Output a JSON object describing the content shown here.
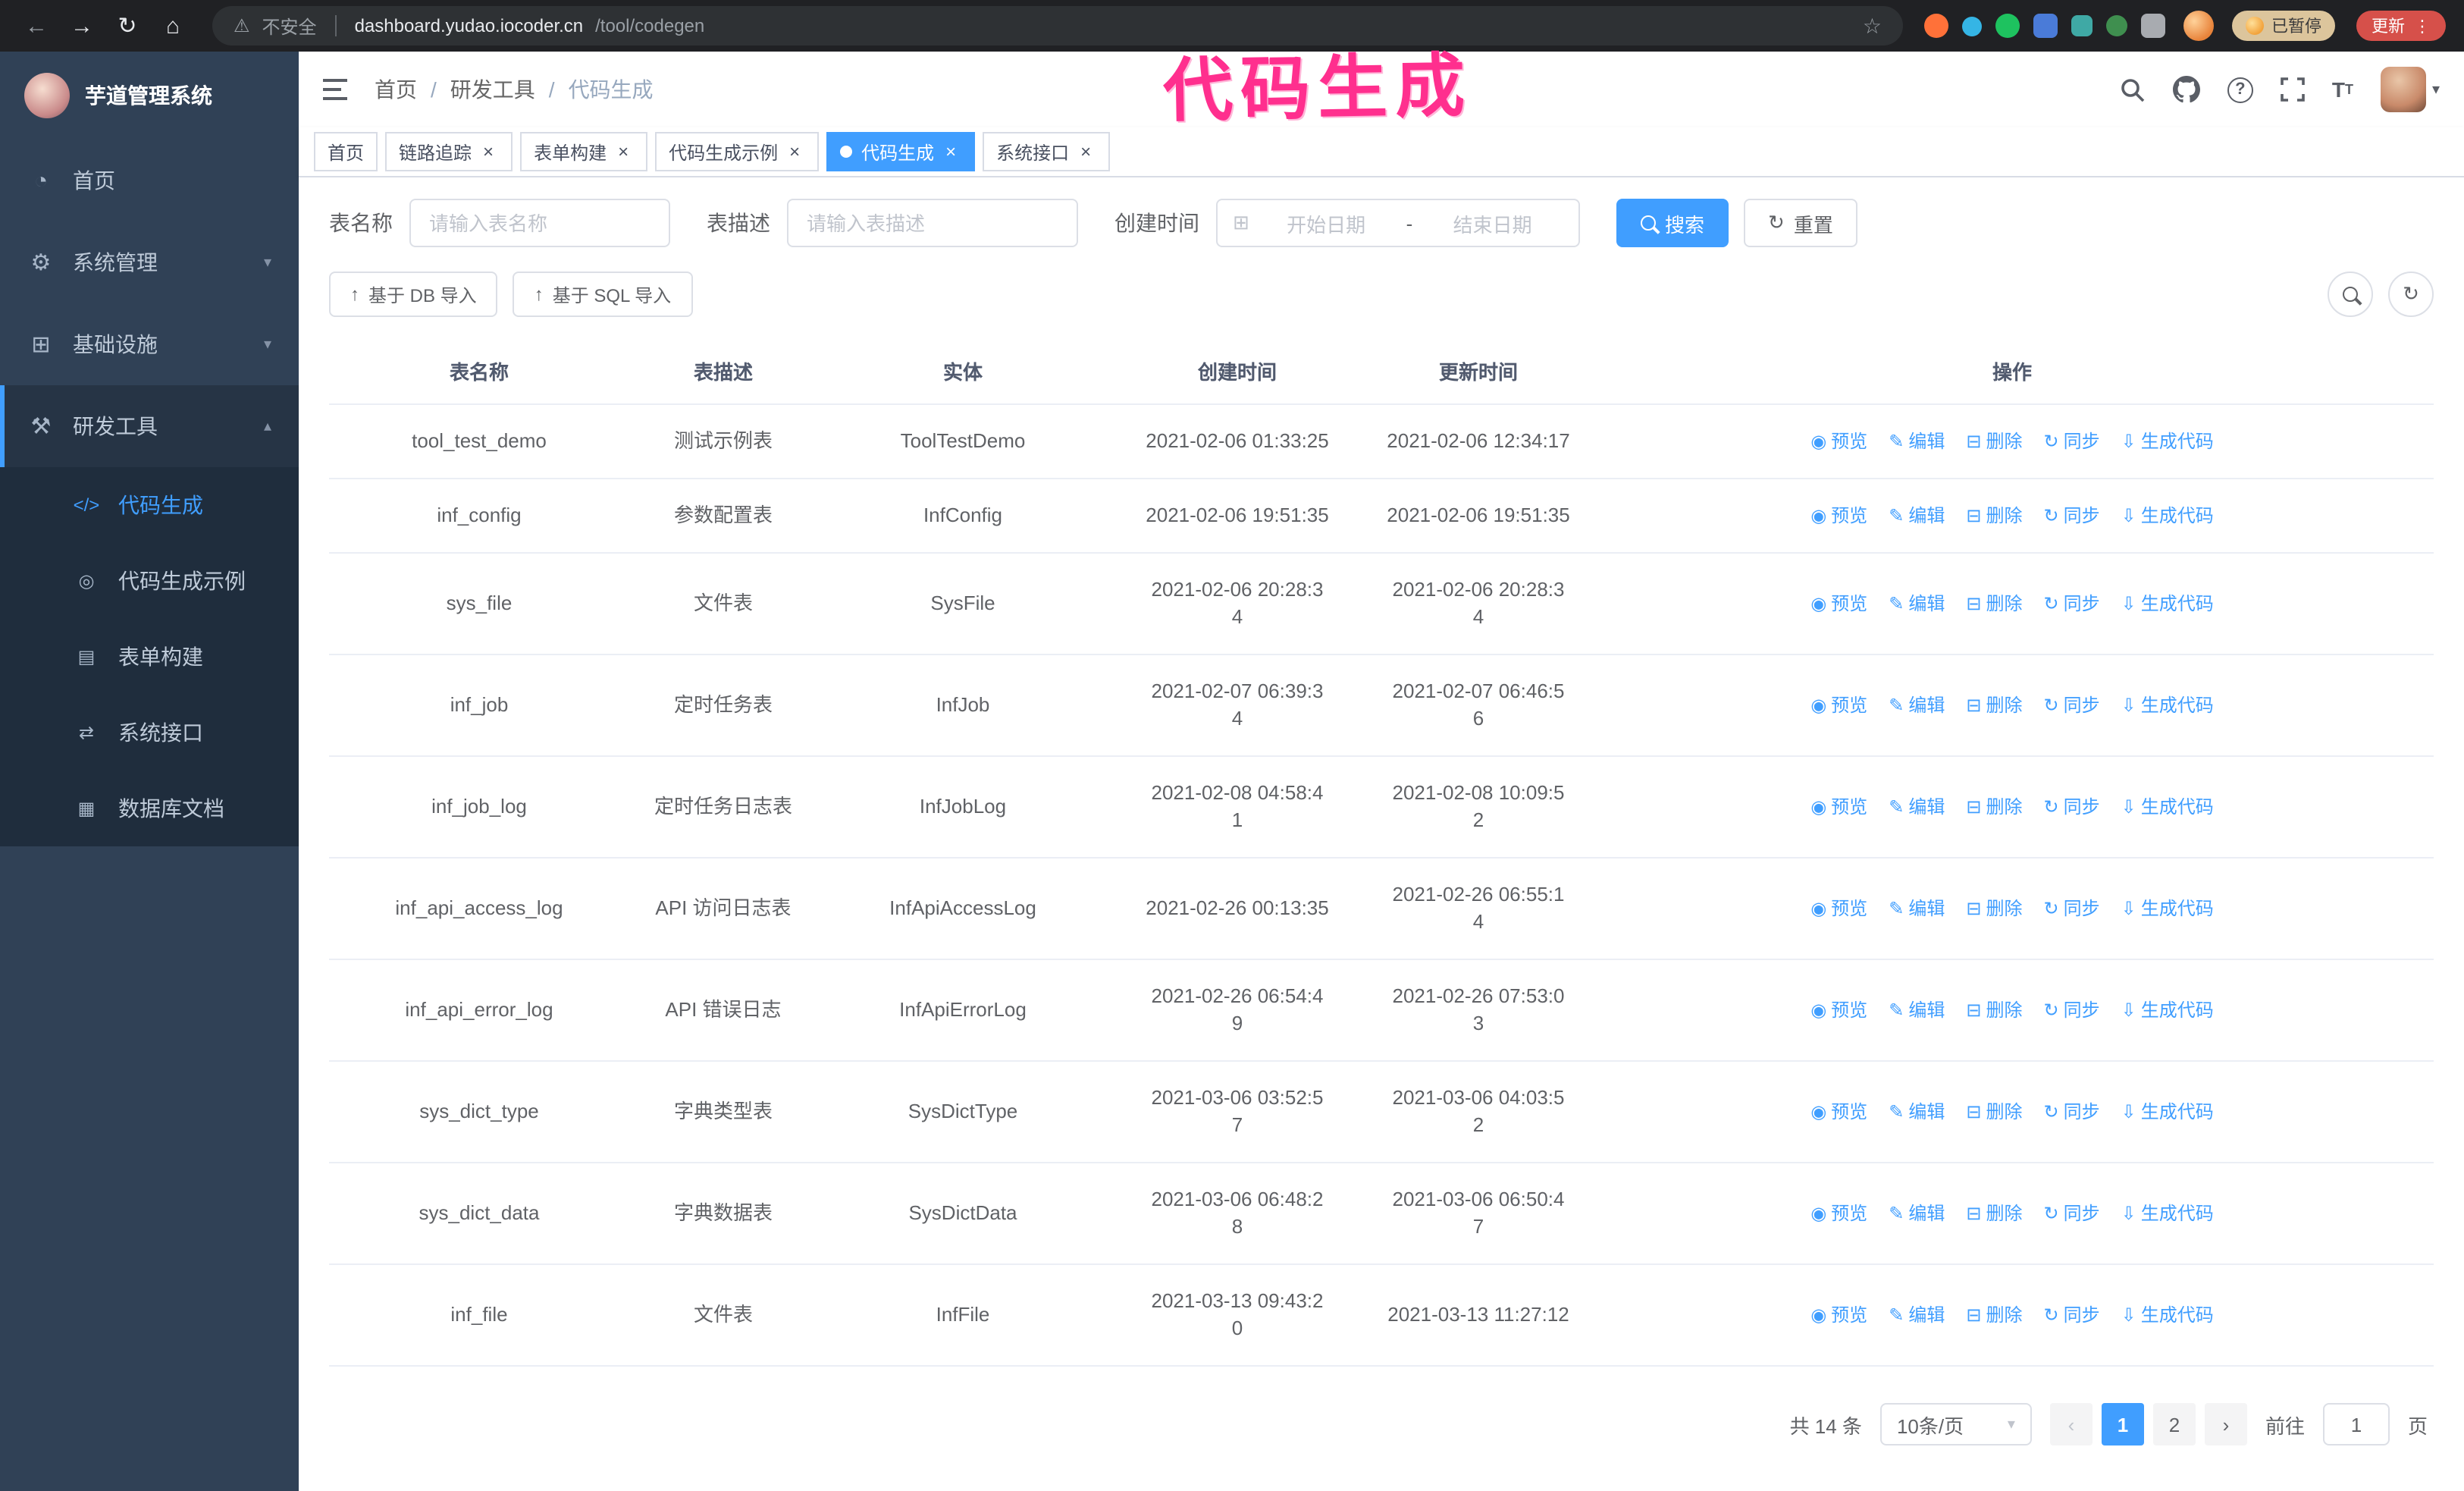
{
  "browser": {
    "security_label": "不安全",
    "url_domain": "dashboard.yudao.iocoder.cn",
    "url_path": "/tool/codegen",
    "paused_badge": "已暂停",
    "update_label": "更新"
  },
  "annotation_text": "代码生成",
  "sidebar": {
    "logo_title": "芋道管理系统",
    "items": [
      {
        "label": "首页",
        "icon": "◔"
      },
      {
        "label": "系统管理",
        "icon": "⚙",
        "chevron": "▾"
      },
      {
        "label": "基础设施",
        "icon": "⊞",
        "chevron": "▾"
      },
      {
        "label": "研发工具",
        "icon": "⚒",
        "chevron": "▴"
      }
    ],
    "subitems": [
      {
        "label": "代码生成",
        "icon": "</>"
      },
      {
        "label": "代码生成示例",
        "icon": "◎"
      },
      {
        "label": "表单构建",
        "icon": "▤"
      },
      {
        "label": "系统接口",
        "icon": "⇄"
      },
      {
        "label": "数据库文档",
        "icon": "▦"
      }
    ]
  },
  "breadcrumb": {
    "items": [
      "首页",
      "研发工具",
      "代码生成"
    ],
    "separator": "/"
  },
  "tabs": [
    {
      "label": "首页"
    },
    {
      "label": "链路追踪"
    },
    {
      "label": "表单构建"
    },
    {
      "label": "代码生成示例"
    },
    {
      "label": "代码生成"
    },
    {
      "label": "系统接口"
    }
  ],
  "filters": {
    "table_name_label": "表名称",
    "table_name_placeholder": "请输入表名称",
    "table_desc_label": "表描述",
    "table_desc_placeholder": "请输入表描述",
    "create_time_label": "创建时间",
    "date_start_placeholder": "开始日期",
    "date_separator": "-",
    "date_end_placeholder": "结束日期",
    "search_button": "搜索",
    "reset_button": "重置"
  },
  "toolbar": {
    "import_db": "基于 DB 导入",
    "import_sql": "基于 SQL 导入"
  },
  "table": {
    "columns": [
      "表名称",
      "表描述",
      "实体",
      "创建时间",
      "更新时间",
      "操作"
    ],
    "actions": [
      "预览",
      "编辑",
      "删除",
      "同步",
      "生成代码"
    ],
    "rows": [
      {
        "name": "tool_test_demo",
        "desc": "测试示例表",
        "entity": "ToolTestDemo",
        "created": "2021-02-06 01:33:25",
        "updated": "2021-02-06 12:34:17"
      },
      {
        "name": "inf_config",
        "desc": "参数配置表",
        "entity": "InfConfig",
        "created": "2021-02-06 19:51:35",
        "updated": "2021-02-06 19:51:35"
      },
      {
        "name": "sys_file",
        "desc": "文件表",
        "entity": "SysFile",
        "created": "2021-02-06 20:28:34",
        "updated": "2021-02-06 20:28:34"
      },
      {
        "name": "inf_job",
        "desc": "定时任务表",
        "entity": "InfJob",
        "created": "2021-02-07 06:39:34",
        "updated": "2021-02-07 06:46:56"
      },
      {
        "name": "inf_job_log",
        "desc": "定时任务日志表",
        "entity": "InfJobLog",
        "created": "2021-02-08 04:58:41",
        "updated": "2021-02-08 10:09:52"
      },
      {
        "name": "inf_api_access_log",
        "desc": "API 访问日志表",
        "entity": "InfApiAccessLog",
        "created": "2021-02-26 00:13:35",
        "updated": "2021-02-26 06:55:14"
      },
      {
        "name": "inf_api_error_log",
        "desc": "API 错误日志",
        "entity": "InfApiErrorLog",
        "created": "2021-02-26 06:54:49",
        "updated": "2021-02-26 07:53:03"
      },
      {
        "name": "sys_dict_type",
        "desc": "字典类型表",
        "entity": "SysDictType",
        "created": "2021-03-06 03:52:57",
        "updated": "2021-03-06 04:03:52"
      },
      {
        "name": "sys_dict_data",
        "desc": "字典数据表",
        "entity": "SysDictData",
        "created": "2021-03-06 06:48:28",
        "updated": "2021-03-06 06:50:47"
      },
      {
        "name": "inf_file",
        "desc": "文件表",
        "entity": "InfFile",
        "created": "2021-03-13 09:43:20",
        "updated": "2021-03-13 11:27:12"
      }
    ]
  },
  "pagination": {
    "total": "共 14 条",
    "page_size": "10条/页",
    "prev": "‹",
    "next": "›",
    "pages": [
      "1",
      "2"
    ],
    "goto_label": "前往",
    "goto_value": "1",
    "page_unit": "页"
  }
}
